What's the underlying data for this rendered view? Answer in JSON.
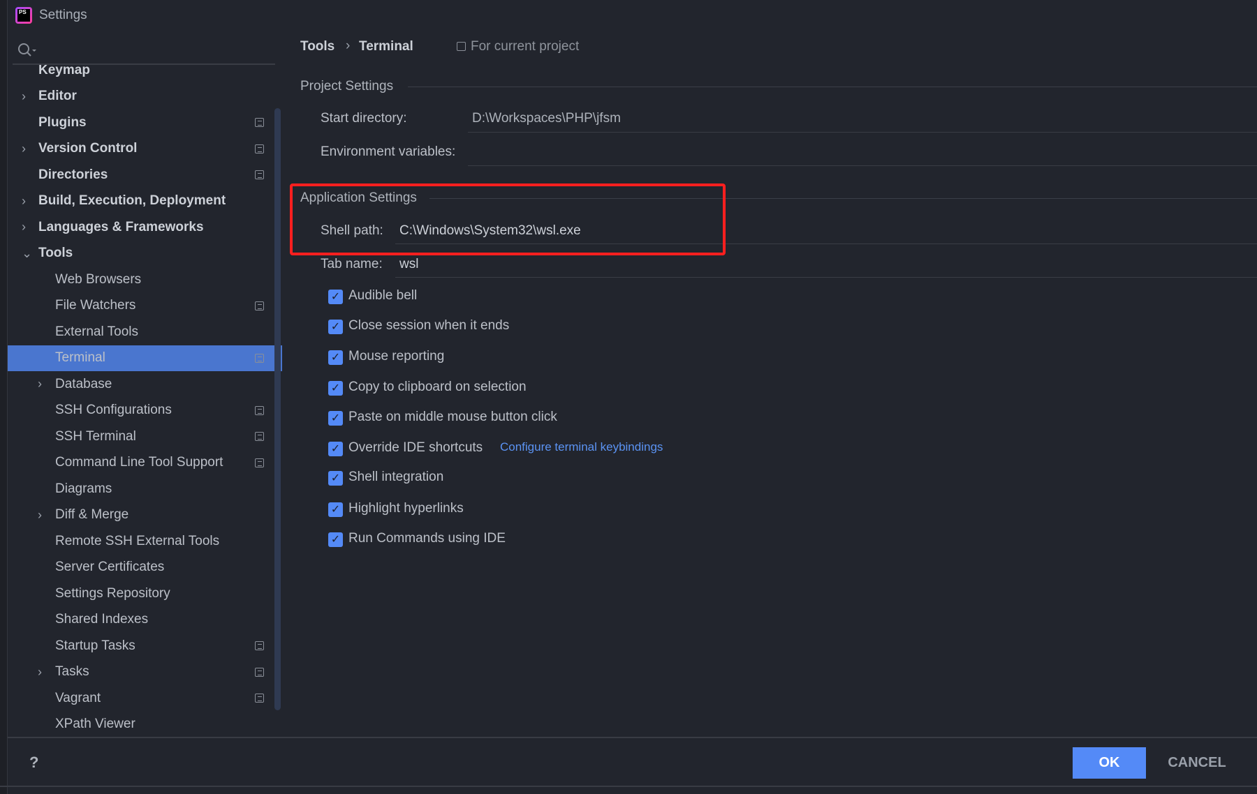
{
  "window": {
    "title": "Settings",
    "logo_text": "PS"
  },
  "sidebar": {
    "items": [
      {
        "label": "Keymap",
        "level": 0,
        "chev": "",
        "icon": false
      },
      {
        "label": "Editor",
        "level": 0,
        "chev": "›",
        "icon": false
      },
      {
        "label": "Plugins",
        "level": 0,
        "chev": "",
        "icon": true
      },
      {
        "label": "Version Control",
        "level": 0,
        "chev": "›",
        "icon": true
      },
      {
        "label": "Directories",
        "level": 0,
        "chev": "",
        "icon": true
      },
      {
        "label": "Build, Execution, Deployment",
        "level": 0,
        "chev": "›",
        "icon": false
      },
      {
        "label": "Languages & Frameworks",
        "level": 0,
        "chev": "›",
        "icon": false
      },
      {
        "label": "Tools",
        "level": 0,
        "chev": "⌄",
        "icon": false
      },
      {
        "label": "Web Browsers",
        "level": 1,
        "chev": "",
        "icon": false
      },
      {
        "label": "File Watchers",
        "level": 1,
        "chev": "",
        "icon": true
      },
      {
        "label": "External Tools",
        "level": 1,
        "chev": "",
        "icon": false
      },
      {
        "label": "Terminal",
        "level": 1,
        "chev": "",
        "icon": true,
        "selected": true
      },
      {
        "label": "Database",
        "level": 1,
        "chev": "›",
        "icon": false
      },
      {
        "label": "SSH Configurations",
        "level": 1,
        "chev": "",
        "icon": true
      },
      {
        "label": "SSH Terminal",
        "level": 1,
        "chev": "",
        "icon": true
      },
      {
        "label": "Command Line Tool Support",
        "level": 1,
        "chev": "",
        "icon": true
      },
      {
        "label": "Diagrams",
        "level": 1,
        "chev": "",
        "icon": false
      },
      {
        "label": "Diff & Merge",
        "level": 1,
        "chev": "›",
        "icon": false
      },
      {
        "label": "Remote SSH External Tools",
        "level": 1,
        "chev": "",
        "icon": false
      },
      {
        "label": "Server Certificates",
        "level": 1,
        "chev": "",
        "icon": false
      },
      {
        "label": "Settings Repository",
        "level": 1,
        "chev": "",
        "icon": false
      },
      {
        "label": "Shared Indexes",
        "level": 1,
        "chev": "",
        "icon": false
      },
      {
        "label": "Startup Tasks",
        "level": 1,
        "chev": "",
        "icon": true
      },
      {
        "label": "Tasks",
        "level": 1,
        "chev": "›",
        "icon": true
      },
      {
        "label": "Vagrant",
        "level": 1,
        "chev": "",
        "icon": true
      },
      {
        "label": "XPath Viewer",
        "level": 1,
        "chev": "",
        "icon": false
      }
    ]
  },
  "breadcrumb": {
    "parent": "Tools",
    "sep": "›",
    "current": "Terminal",
    "scope": "For current project"
  },
  "project": {
    "heading": "Project Settings",
    "start_dir_label": "Start directory:",
    "start_dir_value": "D:\\Workspaces\\PHP\\jfsm",
    "env_label": "Environment variables:",
    "env_value": ""
  },
  "app": {
    "heading": "Application Settings",
    "shell_label": "Shell path:",
    "shell_value": "C:\\Windows\\System32\\wsl.exe",
    "tab_label": "Tab name:",
    "tab_value": "wsl"
  },
  "checkboxes": [
    {
      "label": "Audible bell",
      "checked": true
    },
    {
      "label": "Close session when it ends",
      "checked": true
    },
    {
      "label": "Mouse reporting",
      "checked": true
    },
    {
      "label": "Copy to clipboard on selection",
      "checked": true
    },
    {
      "label": "Paste on middle mouse button click",
      "checked": true
    },
    {
      "label": "Override IDE shortcuts",
      "checked": true
    },
    {
      "label": "Shell integration",
      "checked": true
    },
    {
      "label": "Highlight hyperlinks",
      "checked": true
    },
    {
      "label": "Run Commands using IDE",
      "checked": true
    }
  ],
  "link": "Configure terminal keybindings",
  "footer": {
    "help": "?",
    "ok": "OK",
    "cancel": "CANCEL"
  },
  "colors": {
    "accent": "#548af7",
    "selection": "#4a76cf",
    "highlight_box": "#ff1f1f",
    "link": "#5b93f3"
  }
}
